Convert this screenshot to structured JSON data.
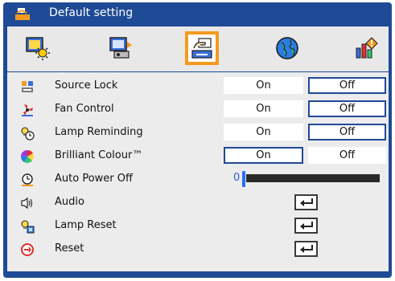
{
  "window": {
    "title": "Default setting"
  },
  "tabs": [
    {
      "name": "image-settings-tab",
      "icon": "image-sun-icon",
      "selected": false
    },
    {
      "name": "screen-settings-tab",
      "icon": "screen-projector-icon",
      "selected": false
    },
    {
      "name": "settings-tab",
      "icon": "hand-settings-icon",
      "selected": true
    },
    {
      "name": "language-tab",
      "icon": "globe-icon",
      "selected": false
    },
    {
      "name": "management-tab",
      "icon": "management-chart-icon",
      "selected": false
    }
  ],
  "rows": [
    {
      "label": "Source Lock",
      "icon": "source-lock-icon",
      "on": "On",
      "off": "Off",
      "selected": "off"
    },
    {
      "label": "Fan Control",
      "icon": "fan-control-icon",
      "on": "On",
      "off": "Off",
      "selected": "off"
    },
    {
      "label": "Lamp Reminding",
      "icon": "lamp-reminding-icon",
      "on": "On",
      "off": "Off",
      "selected": "off"
    },
    {
      "label": "Brilliant Colour™",
      "icon": "brilliant-colour-icon",
      "on": "On",
      "off": "Off",
      "selected": "on"
    },
    {
      "label": "Auto Power Off",
      "icon": "auto-power-off-icon",
      "slider_value": "0"
    },
    {
      "label": "Audio",
      "icon": "speaker-icon",
      "action": "enter"
    },
    {
      "label": "Lamp Reset",
      "icon": "lamp-reset-icon",
      "action": "enter"
    },
    {
      "label": "Reset",
      "icon": "reset-icon",
      "action": "enter"
    }
  ],
  "colors": {
    "frame": "#1f4a95",
    "selected_tab": "#f39a1e",
    "panel": "#ececec"
  }
}
